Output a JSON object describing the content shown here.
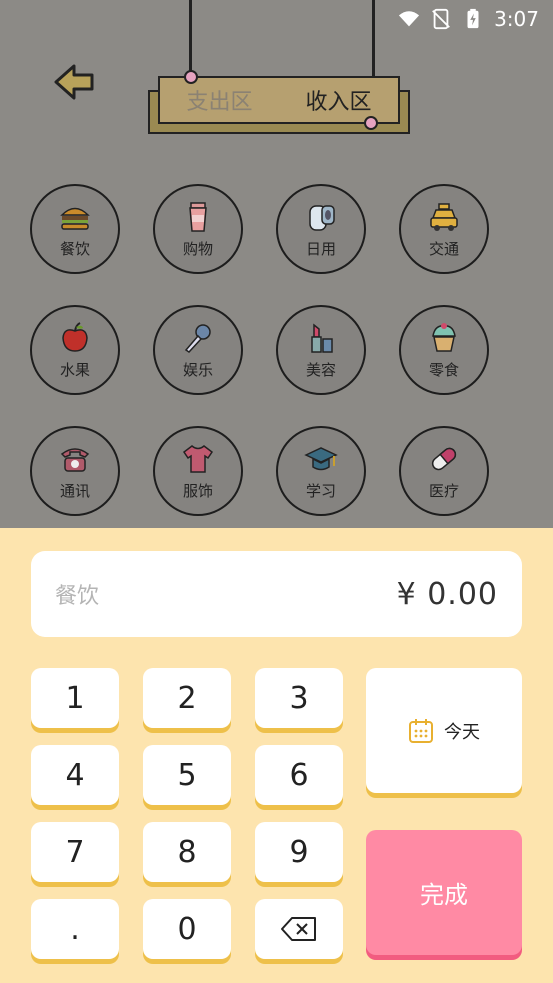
{
  "status_bar": {
    "time": "3:07"
  },
  "header": {
    "tabs": [
      {
        "label": "支出区",
        "active": false
      },
      {
        "label": "收入区",
        "active": true
      }
    ]
  },
  "categories": [
    {
      "label": "餐饮",
      "icon": "burger-icon"
    },
    {
      "label": "购物",
      "icon": "cup-icon"
    },
    {
      "label": "日用",
      "icon": "toilet-paper-icon"
    },
    {
      "label": "交通",
      "icon": "taxi-icon"
    },
    {
      "label": "水果",
      "icon": "apple-icon"
    },
    {
      "label": "娱乐",
      "icon": "microphone-icon"
    },
    {
      "label": "美容",
      "icon": "lipstick-icon"
    },
    {
      "label": "零食",
      "icon": "cupcake-icon"
    },
    {
      "label": "通讯",
      "icon": "telephone-icon"
    },
    {
      "label": "服饰",
      "icon": "shirt-icon"
    },
    {
      "label": "学习",
      "icon": "graduation-cap-icon"
    },
    {
      "label": "医疗",
      "icon": "pill-icon"
    }
  ],
  "entry": {
    "category": "餐饮",
    "currency": "¥",
    "amount": "0.00"
  },
  "keypad": {
    "keys": [
      "1",
      "2",
      "3",
      "4",
      "5",
      "6",
      "7",
      "8",
      "9",
      ".",
      "0"
    ],
    "backspace_icon": "backspace-icon",
    "date_label": "今天",
    "date_icon": "calendar-icon",
    "done_label": "完成"
  },
  "colors": {
    "panel": "#fde4ae",
    "done": "#ff8aa4",
    "key_shadow": "#eec04a",
    "overlay": "#8c8a86"
  }
}
